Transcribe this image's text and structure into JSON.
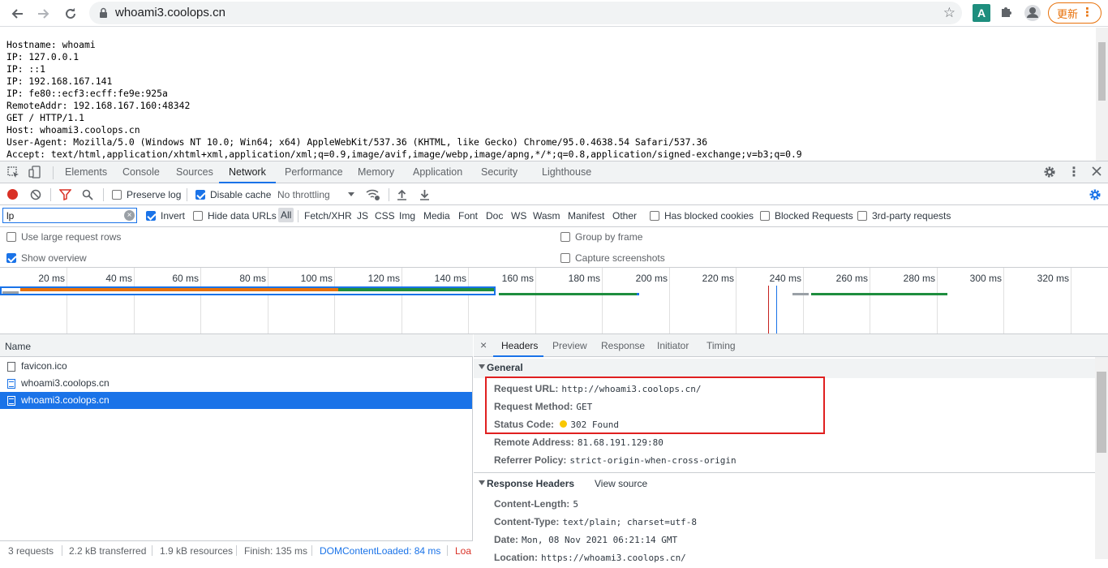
{
  "browser": {
    "url": "whoami3.coolops.cn",
    "update_label": "更新",
    "ext_a_label": "A"
  },
  "page": {
    "lines": [
      "Hostname: whoami",
      "IP: 127.0.0.1",
      "IP: ::1",
      "IP: 192.168.167.141",
      "IP: fe80::ecf3:ecff:fe9e:925a",
      "RemoteAddr: 192.168.167.160:48342",
      "GET / HTTP/1.1",
      "Host: whoami3.coolops.cn",
      "User-Agent: Mozilla/5.0 (Windows NT 10.0; Win64; x64) AppleWebKit/537.36 (KHTML, like Gecko) Chrome/95.0.4638.54 Safari/537.36",
      "Accept: text/html,application/xhtml+xml,application/xml;q=0.9,image/avif,image/webp,image/apng,*/*;q=0.8,application/signed-exchange;v=b3;q=0.9"
    ]
  },
  "devtools": {
    "tabs": [
      "Elements",
      "Console",
      "Sources",
      "Network",
      "Performance",
      "Memory",
      "Application",
      "Security",
      "Lighthouse"
    ],
    "active_tab": "Network",
    "toolbar": {
      "preserve_log": "Preserve log",
      "preserve_log_checked": false,
      "disable_cache": "Disable cache",
      "disable_cache_checked": true,
      "throttling": "No throttling"
    },
    "filter": {
      "value": "lp",
      "invert": "Invert",
      "invert_checked": true,
      "hide_data_urls": "Hide data URLs",
      "types": [
        "All",
        "Fetch/XHR",
        "JS",
        "CSS",
        "Img",
        "Media",
        "Font",
        "Doc",
        "WS",
        "Wasm",
        "Manifest",
        "Other"
      ],
      "active_type": "All",
      "has_blocked_cookies": "Has blocked cookies",
      "blocked_requests": "Blocked Requests",
      "third_party": "3rd-party requests"
    },
    "settings": {
      "large_rows": "Use large request rows",
      "large_rows_checked": false,
      "show_overview": "Show overview",
      "show_overview_checked": true,
      "group_by_frame": "Group by frame",
      "capture_screenshots": "Capture screenshots"
    },
    "overview": {
      "ticks": [
        "20 ms",
        "40 ms",
        "60 ms",
        "80 ms",
        "100 ms",
        "120 ms",
        "140 ms",
        "160 ms",
        "180 ms",
        "200 ms",
        "220 ms",
        "240 ms",
        "260 ms",
        "280 ms",
        "300 ms",
        "320 ms"
      ]
    },
    "requests": {
      "header": "Name",
      "rows": [
        {
          "name": "favicon.ico",
          "type": "other",
          "selected": false
        },
        {
          "name": "whoami3.coolops.cn",
          "type": "doc",
          "selected": false
        },
        {
          "name": "whoami3.coolops.cn",
          "type": "doc",
          "selected": true
        }
      ]
    },
    "statusbar": {
      "requests": "3 requests",
      "transferred": "2.2 kB transferred",
      "resources": "1.9 kB resources",
      "finish": "Finish: 135 ms",
      "domcontentloaded": "DOMContentLoaded: 84 ms",
      "load": "Loa"
    },
    "details": {
      "close": "×",
      "tabs": [
        "Headers",
        "Preview",
        "Response",
        "Initiator",
        "Timing"
      ],
      "active_tab": "Headers",
      "general_title": "General",
      "general": [
        {
          "key": "Request URL:",
          "value": "http://whoami3.coolops.cn/"
        },
        {
          "key": "Request Method:",
          "value": "GET"
        },
        {
          "key": "Status Code:",
          "value": "302 Found",
          "status_dot": "#f9c700"
        },
        {
          "key": "Remote Address:",
          "value": "81.68.191.129:80"
        },
        {
          "key": "Referrer Policy:",
          "value": "strict-origin-when-cross-origin"
        }
      ],
      "response_title": "Response Headers",
      "view_source": "View source",
      "response": [
        {
          "key": "Content-Length:",
          "value": "5"
        },
        {
          "key": "Content-Type:",
          "value": "text/plain; charset=utf-8"
        },
        {
          "key": "Date:",
          "value": "Mon, 08 Nov 2021 06:21:14 GMT"
        },
        {
          "key": "Location:",
          "value": "https://whoami3.coolops.cn/"
        }
      ]
    }
  },
  "colors": {
    "accent": "#1a73e8",
    "record_red": "#d93025",
    "update_orange": "#e8710a",
    "highlight_red": "#e02020"
  }
}
